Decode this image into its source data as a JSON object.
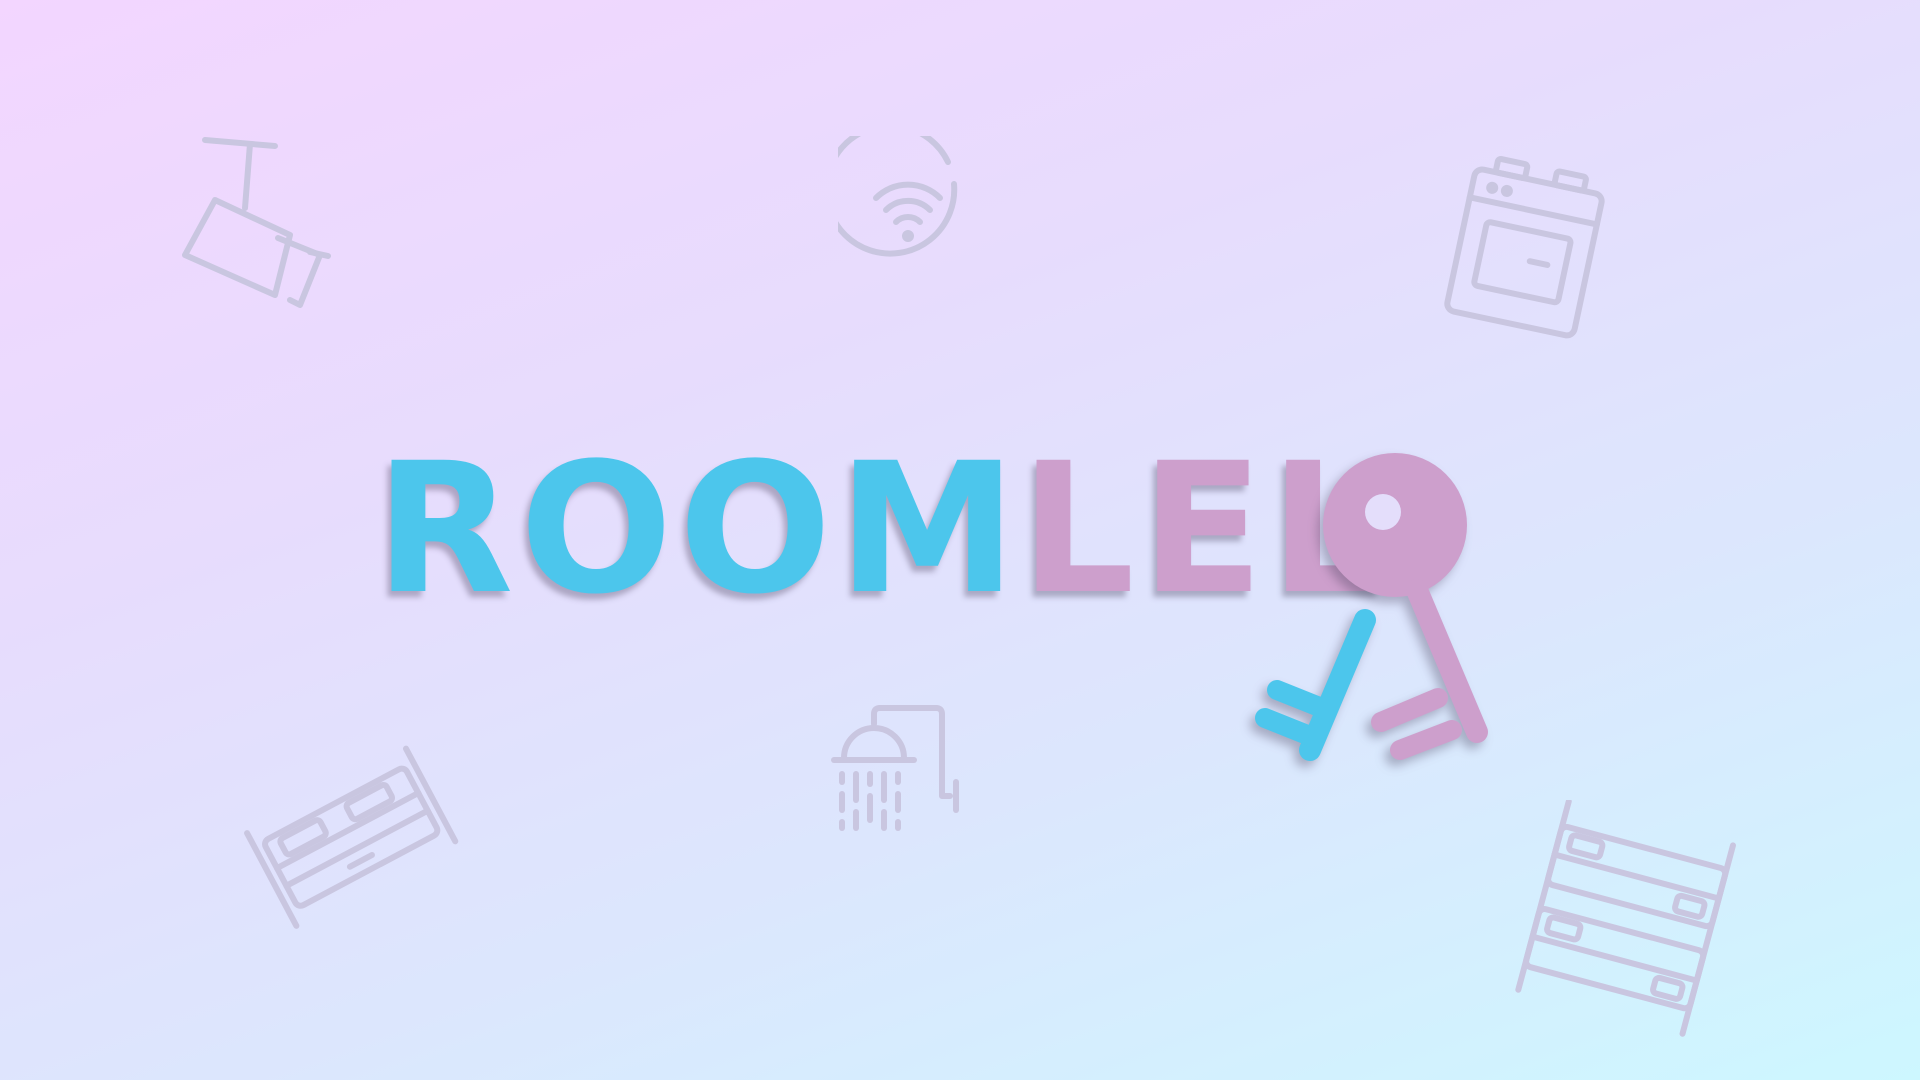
{
  "logo": {
    "part1": "ROOM",
    "part2": "LEL",
    "icon": "key-icon"
  },
  "colors": {
    "primary": "#4cc6ec",
    "secondary": "#cd9fcc",
    "icon_stroke": "#c9c6e0",
    "background_top_right": "#f3d6ff",
    "background_bottom_left": "#cdf7ff"
  },
  "decorations": [
    "cctv-camera-icon",
    "wifi-icon",
    "oven-icon",
    "double-bed-icon",
    "shower-icon",
    "bunk-bed-icon"
  ]
}
